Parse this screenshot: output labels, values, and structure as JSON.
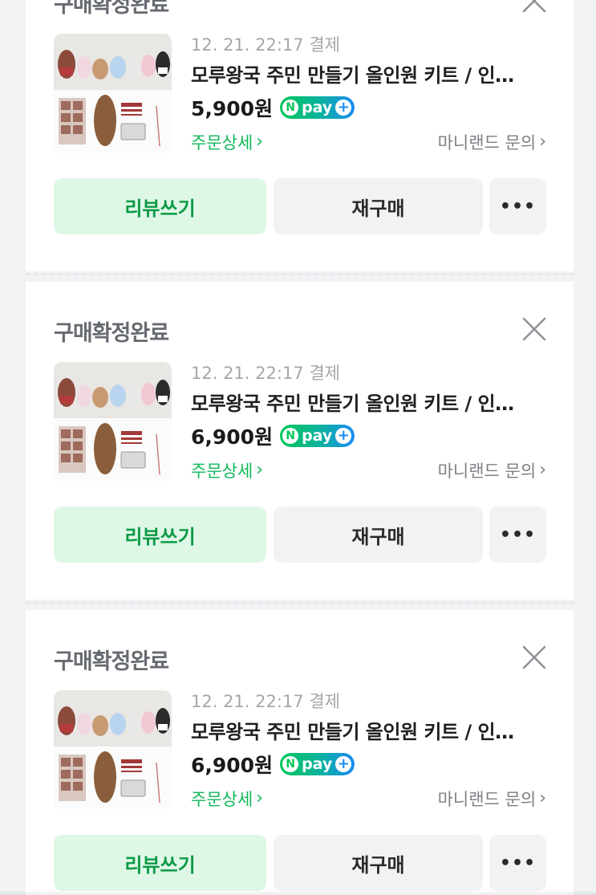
{
  "orders": [
    {
      "status": "구매확정완료",
      "date": "12. 21. 22:17 결제",
      "title": "모루왕국 주민 만들기 올인원 키트 / 인…",
      "price": "5,900원",
      "npay": "pay",
      "detail_label": "주문상세",
      "inquiry_label": "마니랜드 문의",
      "review_label": "리뷰쓰기",
      "rebuy_label": "재구매",
      "more_label": "•••"
    },
    {
      "status": "구매확정완료",
      "date": "12. 21. 22:17 결제",
      "title": "모루왕국 주민 만들기 올인원 키트 / 인…",
      "price": "6,900원",
      "npay": "pay",
      "detail_label": "주문상세",
      "inquiry_label": "마니랜드 문의",
      "review_label": "리뷰쓰기",
      "rebuy_label": "재구매",
      "more_label": "•••"
    },
    {
      "status": "구매확정완료",
      "date": "12. 21. 22:17 결제",
      "title": "모루왕국 주민 만들기 올인원 키트 / 인…",
      "price": "6,900원",
      "npay": "pay",
      "detail_label": "주문상세",
      "inquiry_label": "마니랜드 문의",
      "review_label": "리뷰쓰기",
      "rebuy_label": "재구매",
      "more_label": "•••"
    }
  ],
  "colors": {
    "brand_green": "#03c75a",
    "review_bg": "#dff7e6",
    "review_text": "#0b9a45",
    "neutral_button": "#f1f2f4",
    "status_text": "#666a70"
  },
  "icons": {
    "close": "close-icon",
    "chevron": "chevron-right-icon",
    "npay": "naver-pay-logo"
  }
}
